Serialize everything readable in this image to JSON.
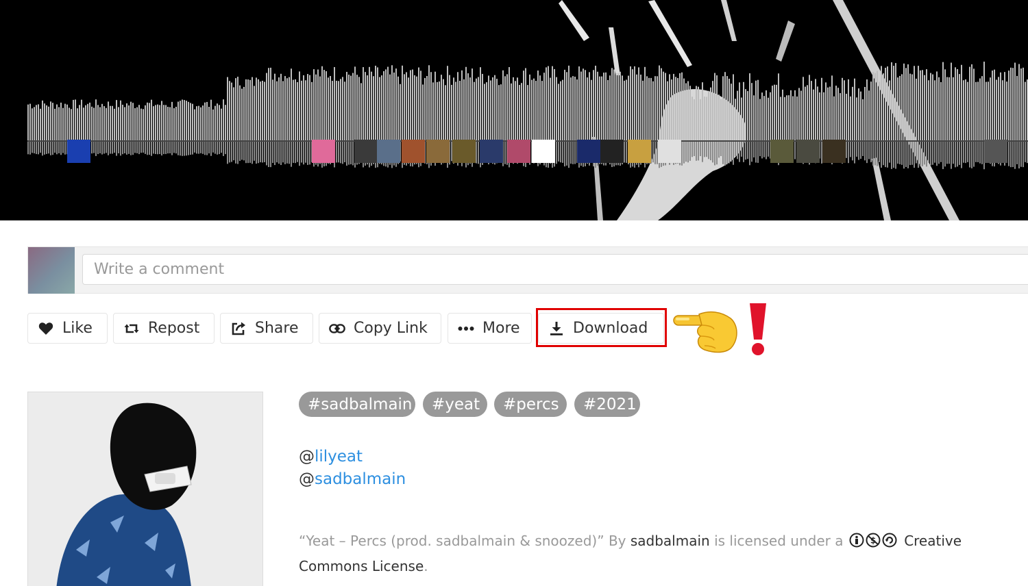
{
  "player": {
    "commenter_avatars": [
      "avatar-blue-hoodie",
      "avatar-pink-face",
      "avatar-group",
      "avatar-masked",
      "avatar-costume",
      "avatar-eyes",
      "avatar-masked-2",
      "avatar-white",
      "avatar-blue-figure",
      "avatar-silhouette",
      "avatar-shapes",
      "avatar-default",
      "avatar-group-2",
      "avatar-dark",
      "avatar-dark-2",
      "avatar-dark-3",
      "avatar-end"
    ]
  },
  "comment": {
    "placeholder": "Write a comment"
  },
  "actions": {
    "like": "Like",
    "repost": "Repost",
    "share": "Share",
    "copy_link": "Copy Link",
    "more": "More",
    "download": "Download"
  },
  "annotation": {
    "pointer_emoji": "👉",
    "exclamation": "!",
    "highlight_color": "#e00000"
  },
  "tags": [
    "sadbalmain",
    "yeat",
    "percs",
    "2021"
  ],
  "tag_prefix": "#",
  "description": {
    "mention_prefix": "@",
    "mentions": [
      "lilyeat",
      "sadbalmain"
    ]
  },
  "license": {
    "quote": "“Yeat – Percs (prod. sadbalmain & snoozed)”",
    "by": "By",
    "author": "sadbalmain",
    "licensed": "is licensed under a",
    "cc_label": "Creative Commons License",
    "period": "."
  },
  "colors": {
    "link": "#2d8fe0",
    "tag_bg": "#999999",
    "waveform": "#bdbdbd"
  }
}
